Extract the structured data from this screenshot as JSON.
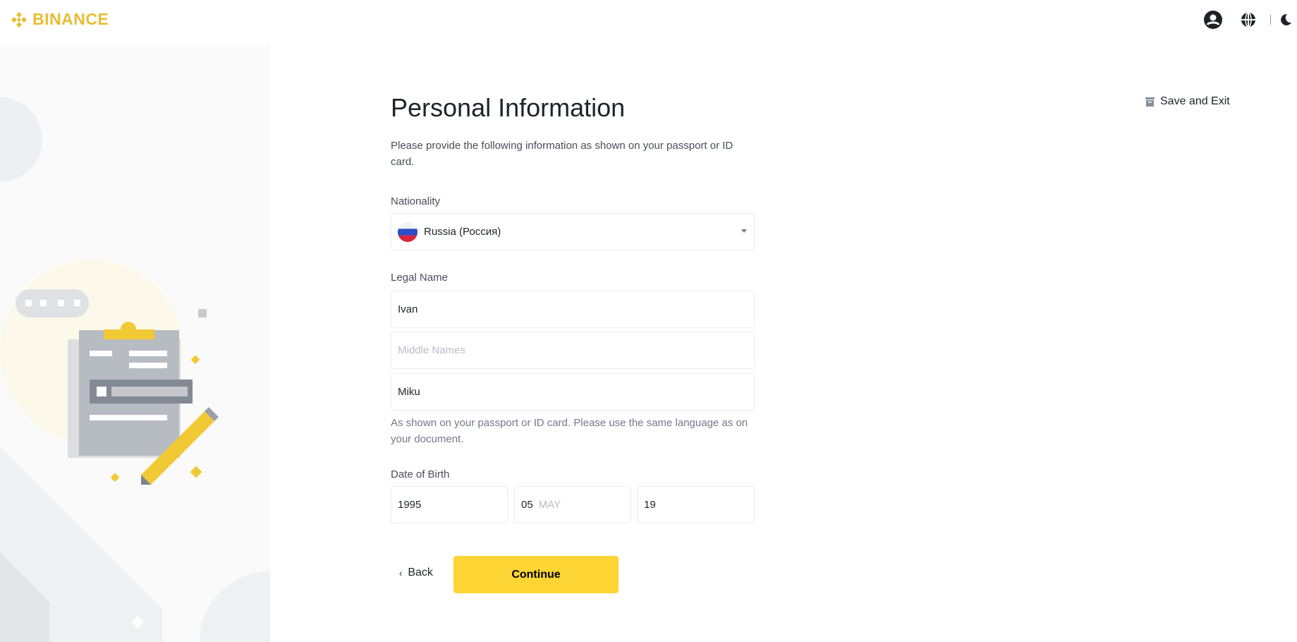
{
  "header": {
    "brand": "BINANCE",
    "brand_color": "#F0B90B",
    "icons": [
      "user-icon",
      "globe-icon",
      "moon-icon"
    ]
  },
  "page": {
    "title": "Personal Information",
    "subtitle": "Please provide the following information as shown on your passport or ID card.",
    "save_exit": "Save and Exit"
  },
  "nationality": {
    "label": "Nationality",
    "value": "Russia (Россия)",
    "flag": "russia-flag"
  },
  "legal_name": {
    "label": "Legal Name",
    "first": "Ivan",
    "middle_placeholder": "Middle Names",
    "last": "Miku",
    "helper": "As shown on your passport or ID card. Please use the same language as on your document."
  },
  "dob": {
    "label": "Date of Birth",
    "year": "1995",
    "month": "05",
    "month_name": "MAY",
    "day": "19"
  },
  "actions": {
    "back": "Back",
    "continue": "Continue",
    "accent": "#FCD535"
  }
}
